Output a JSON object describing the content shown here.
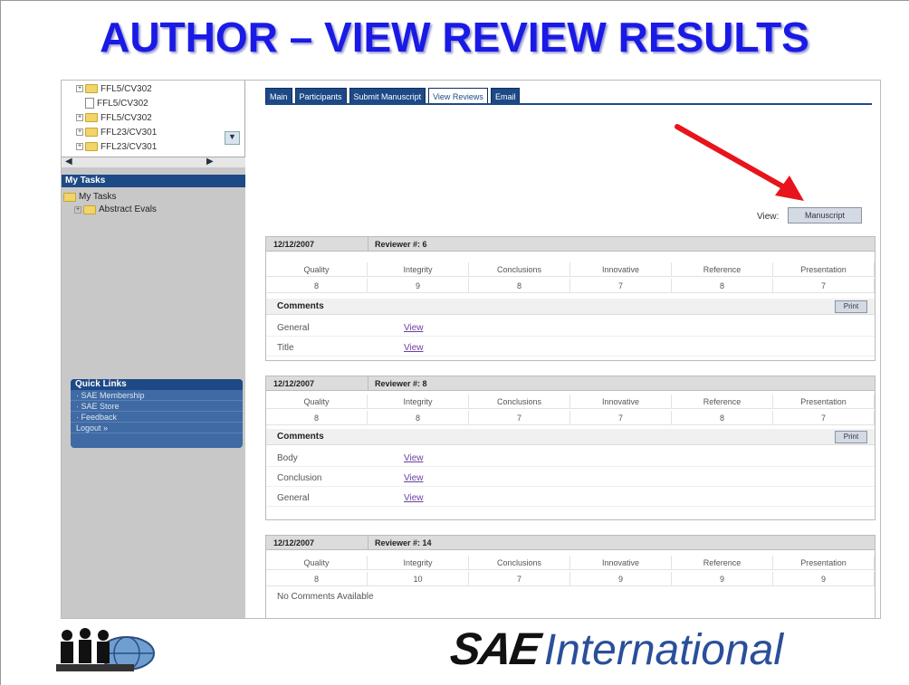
{
  "slide": {
    "title": "AUTHOR – VIEW REVIEW RESULTS"
  },
  "sidebar": {
    "tree_items": [
      "FFL5/CV302",
      "FFL5/CV302",
      "FFL5/CV302",
      "FFL23/CV301",
      "FFL23/CV301"
    ],
    "my_tasks_header": "My Tasks",
    "task_root": "My Tasks",
    "task_child": "Abstract Evals",
    "quick_links_header": "Quick Links",
    "quick_links": [
      "· SAE Membership",
      "· SAE Store",
      "· Feedback",
      "Logout »"
    ]
  },
  "tabs": [
    "Main",
    "Participants",
    "Submit Manuscript",
    "View Reviews",
    "Email"
  ],
  "active_tab": "View Reviews",
  "view_label": "View:",
  "manuscript_button": "Manuscript",
  "score_headers": [
    "Quality",
    "Integrity",
    "Conclusions",
    "Innovative",
    "Reference",
    "Presentation"
  ],
  "comments_label": "Comments",
  "print_label": "Print",
  "view_link": "View",
  "reviews": [
    {
      "date": "12/12/2007",
      "reviewer": "Reviewer #: 6",
      "scores": [
        "8",
        "9",
        "8",
        "7",
        "8",
        "7"
      ],
      "comments": [
        "General",
        "Title"
      ]
    },
    {
      "date": "12/12/2007",
      "reviewer": "Reviewer #: 8",
      "scores": [
        "8",
        "8",
        "7",
        "7",
        "8",
        "7"
      ],
      "comments": [
        "Body",
        "Conclusion",
        "General"
      ]
    },
    {
      "date": "12/12/2007",
      "reviewer": "Reviewer #: 14",
      "scores": [
        "8",
        "10",
        "7",
        "9",
        "9",
        "9"
      ],
      "no_comments": "No Comments Available"
    }
  ],
  "logos": {
    "sae_bold": "SAE",
    "sae_intl": "International"
  },
  "colors": {
    "title": "#1a1ae6",
    "nav_blue": "#1d4a86",
    "arrow": "#e8141b",
    "link": "#6b3fa0"
  }
}
